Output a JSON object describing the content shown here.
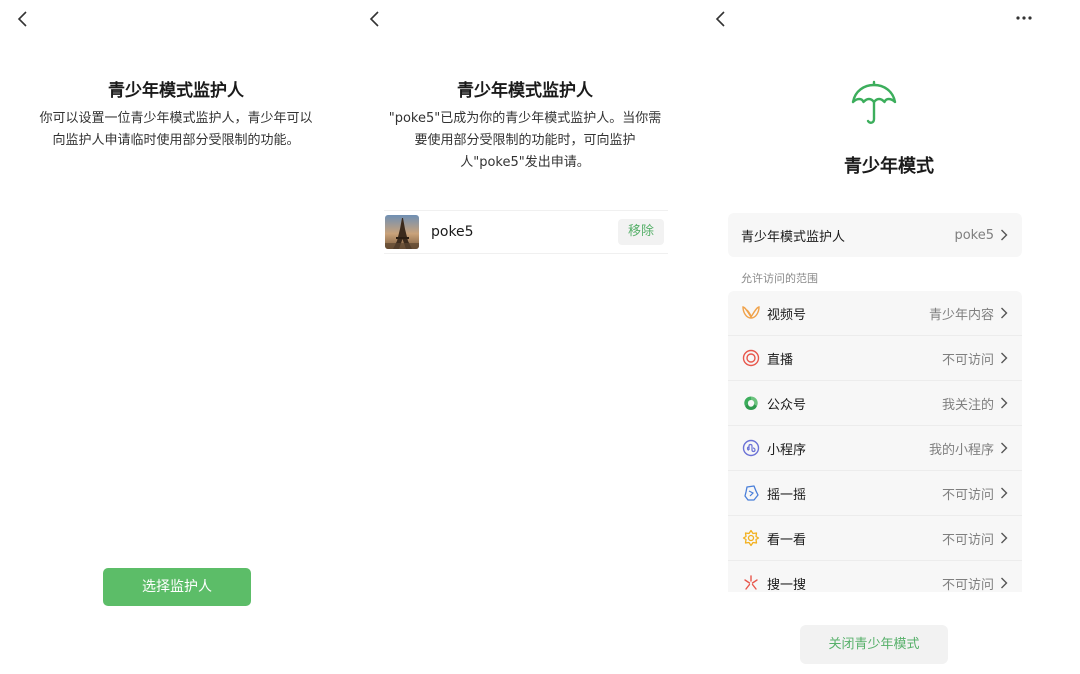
{
  "panel1": {
    "title": "青少年模式监护人",
    "desc_line1": "你可以设置一位青少年模式监护人，青少年可以",
    "desc_line2": "向监护人申请临时使用部分受限制的功能。",
    "select_button": "选择监护人"
  },
  "panel2": {
    "title": "青少年模式监护人",
    "desc_line1": "\"poke5\"已成为你的青少年模式监护人。当你需",
    "desc_line2": "要使用部分受限制的功能时，可向监护",
    "desc_line3": "人\"poke5\"发出申请。",
    "guardian_name": "poke5",
    "remove_button": "移除"
  },
  "panel3": {
    "title": "青少年模式",
    "guardian_label": "青少年模式监护人",
    "guardian_value": "poke5",
    "section_label": "允许访问的范围",
    "scope": [
      {
        "label": "视频号",
        "value": "青少年内容",
        "icon": "channels-icon",
        "color": "#f0a24a"
      },
      {
        "label": "直播",
        "value": "不可访问",
        "icon": "live-icon",
        "color": "#e8574c"
      },
      {
        "label": "公众号",
        "value": "我关注的",
        "icon": "official-accounts-icon",
        "color": "#3cae5c"
      },
      {
        "label": "小程序",
        "value": "我的小程序",
        "icon": "mini-program-icon",
        "color": "#6b72d6"
      },
      {
        "label": "摇一摇",
        "value": "不可访问",
        "icon": "shake-icon",
        "color": "#4a7fd9"
      },
      {
        "label": "看一看",
        "value": "不可访问",
        "icon": "top-stories-icon",
        "color": "#f2b01e"
      },
      {
        "label": "搜一搜",
        "value": "不可访问",
        "icon": "search-icon",
        "color": "#e8574c"
      }
    ],
    "close_button": "关闭青少年模式"
  },
  "colors": {
    "accent": "#5cbd68",
    "accent_text": "#57b06a"
  }
}
